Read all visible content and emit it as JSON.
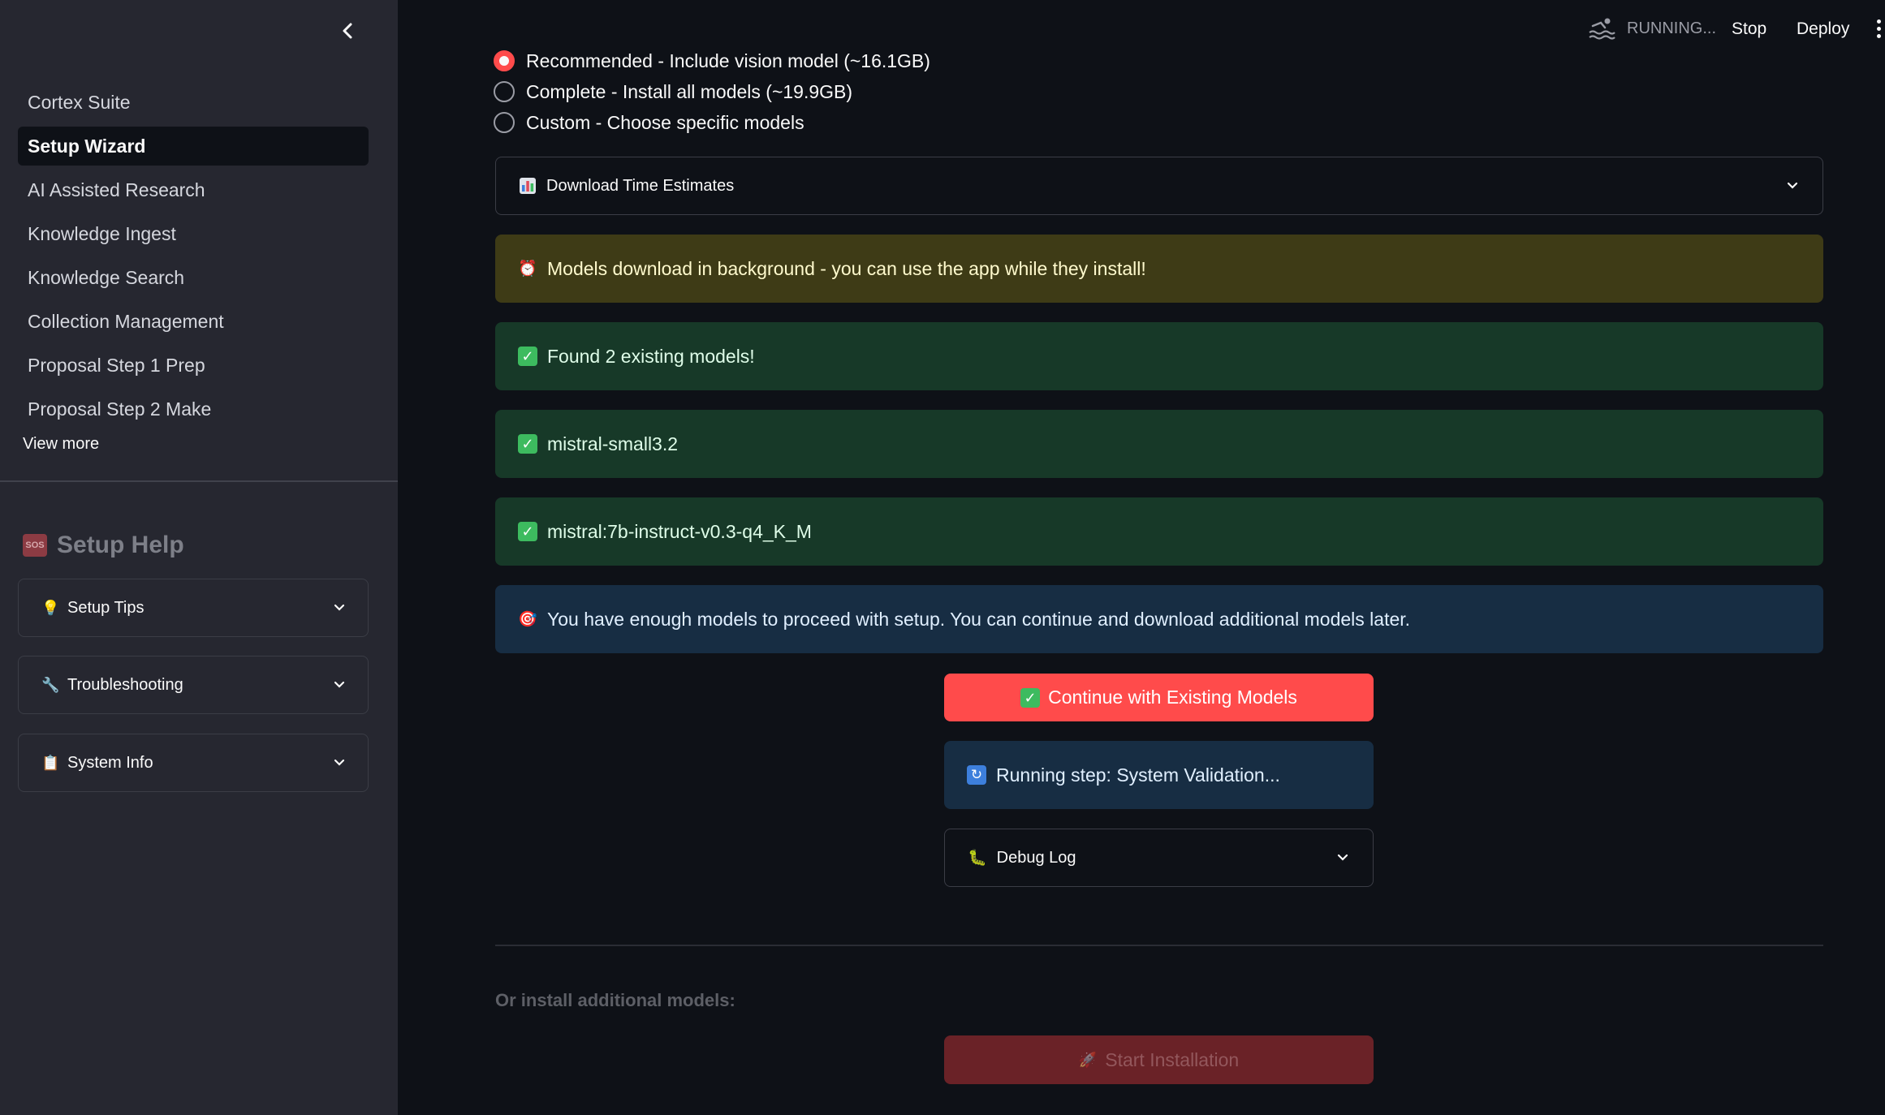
{
  "sidebar": {
    "nav_items": [
      {
        "label": "Cortex Suite",
        "active": false
      },
      {
        "label": "Setup Wizard",
        "active": true
      },
      {
        "label": "AI Assisted Research",
        "active": false
      },
      {
        "label": "Knowledge Ingest",
        "active": false
      },
      {
        "label": "Knowledge Search",
        "active": false
      },
      {
        "label": "Collection Management",
        "active": false
      },
      {
        "label": "Proposal Step 1 Prep",
        "active": false
      },
      {
        "label": "Proposal Step 2 Make",
        "active": false
      }
    ],
    "view_more": "View more",
    "help_title": "Setup Help",
    "help_icon_text": "SOS",
    "expanders": [
      {
        "label": "Setup Tips",
        "icon": "lightbulb-icon"
      },
      {
        "label": "Troubleshooting",
        "icon": "wrench-icon"
      },
      {
        "label": "System Info",
        "icon": "clipboard-icon"
      }
    ]
  },
  "header": {
    "status": "RUNNING...",
    "stop_label": "Stop",
    "deploy_label": "Deploy"
  },
  "main": {
    "radio_options": [
      {
        "label": "Recommended - Include vision model (~16.1GB)",
        "selected": true
      },
      {
        "label": "Complete - Install all models (~19.9GB)",
        "selected": false
      },
      {
        "label": "Custom - Choose specific models",
        "selected": false
      }
    ],
    "download_expander": "Download Time Estimates",
    "warning": "Models download in background - you can use the app while they install!",
    "success_found": "Found 2 existing models!",
    "models": [
      "mistral-small3.2",
      "mistral:7b-instruct-v0.3-q4_K_M"
    ],
    "info": "You have enough models to proceed with setup. You can continue and download additional models later.",
    "continue_button": "Continue with Existing Models",
    "running_step": "Running step: System Validation...",
    "debug_expander": "Debug Log",
    "or_text": "Or install additional models:",
    "start_button": "Start Installation"
  },
  "colors": {
    "primary": "#ff4b4b",
    "sidebar_bg": "#262730",
    "main_bg": "#0e1117",
    "success_bg": "#173928",
    "warning_bg": "#3e3b16",
    "info_bg": "#172d43"
  }
}
